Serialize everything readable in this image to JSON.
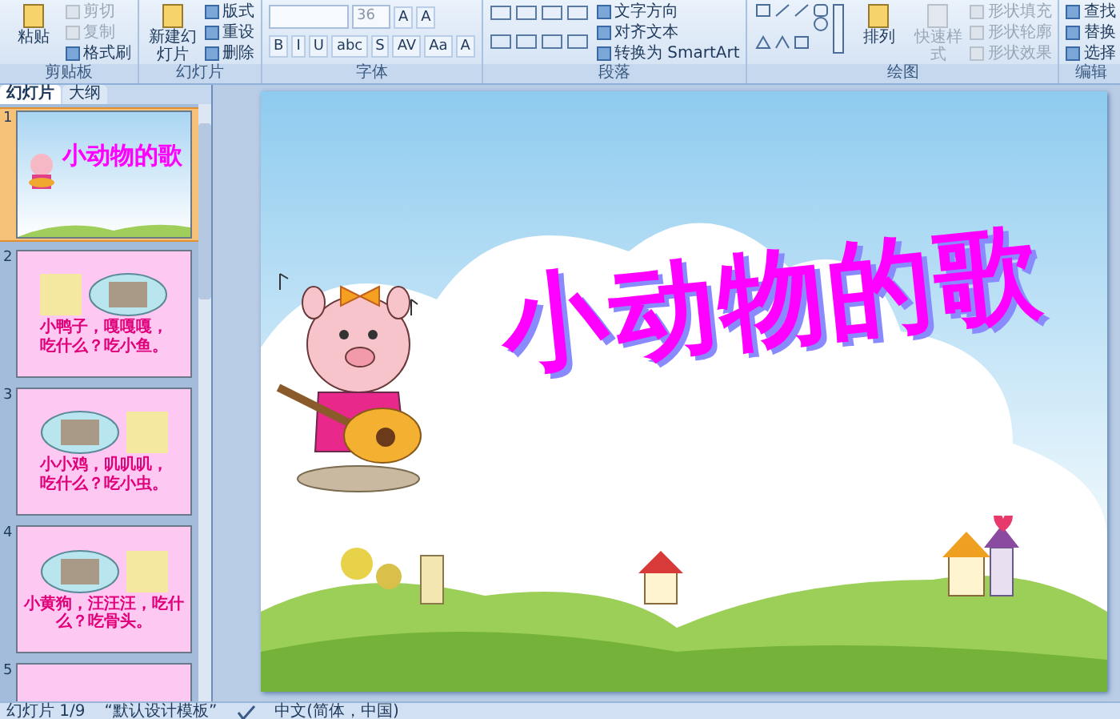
{
  "ribbon": {
    "groups": [
      {
        "label": "剪贴板",
        "kind": "plain",
        "buttons": [
          {
            "kind": "large",
            "label": "粘贴",
            "disabled": false
          },
          {
            "kind": "small",
            "label": "剪切",
            "disabled": true
          },
          {
            "kind": "small",
            "label": "复制",
            "disabled": true
          },
          {
            "kind": "small",
            "label": "格式刷",
            "disabled": false
          }
        ]
      },
      {
        "label": "幻灯片",
        "kind": "plain",
        "buttons": [
          {
            "kind": "large",
            "label": "新建幻灯片",
            "disabled": false
          },
          {
            "kind": "small",
            "label": "版式",
            "disabled": false
          },
          {
            "kind": "small",
            "label": "重设",
            "disabled": false
          },
          {
            "kind": "small",
            "label": "删除",
            "disabled": false
          }
        ]
      },
      {
        "label": "字体",
        "kind": "font",
        "size": "36",
        "glyph_rows": [
          [
            "A",
            "A"
          ],
          [
            "B",
            "I",
            "U",
            "abc",
            "S",
            "AV",
            "Aa",
            "A"
          ]
        ]
      },
      {
        "label": "段落",
        "kind": "paragraph",
        "buttons": [
          {
            "kind": "small",
            "label": "文字方向",
            "disabled": false
          },
          {
            "kind": "small",
            "label": "对齐文本",
            "disabled": false
          },
          {
            "kind": "small",
            "label": "转换为 SmartArt",
            "disabled": false
          }
        ]
      },
      {
        "label": "绘图",
        "kind": "drawing",
        "buttons": [
          {
            "kind": "large",
            "label": "排列",
            "disabled": false
          },
          {
            "kind": "large",
            "label": "快速样式",
            "disabled": true
          },
          {
            "kind": "small",
            "label": "形状填充",
            "disabled": true
          },
          {
            "kind": "small",
            "label": "形状轮廓",
            "disabled": true
          },
          {
            "kind": "small",
            "label": "形状效果",
            "disabled": true
          }
        ]
      },
      {
        "label": "编辑",
        "kind": "plain",
        "buttons": [
          {
            "kind": "small",
            "label": "查找",
            "disabled": false
          },
          {
            "kind": "small",
            "label": "替换",
            "disabled": false
          },
          {
            "kind": "small",
            "label": "选择",
            "disabled": false
          }
        ]
      }
    ]
  },
  "panel": {
    "tabs": [
      {
        "label": "幻灯片",
        "selected": true
      },
      {
        "label": "大纲",
        "selected": false
      }
    ],
    "slides": [
      {
        "number": "1",
        "selected": true,
        "kind": "title",
        "title": "小动物的歌"
      },
      {
        "number": "2",
        "selected": false,
        "kind": "animal-left",
        "lines": [
          "小鸭子，嘎嘎嘎，",
          "吃什么？吃小鱼。"
        ]
      },
      {
        "number": "3",
        "selected": false,
        "kind": "animal-right",
        "lines": [
          "小小鸡，叽叽叽，",
          "吃什么？吃小虫。"
        ]
      },
      {
        "number": "4",
        "selected": false,
        "kind": "animal-right",
        "lines": [
          "小黄狗，汪汪汪，吃什么？吃骨头。"
        ]
      },
      {
        "number": "5",
        "selected": false,
        "kind": "animal-right"
      }
    ]
  },
  "slide": {
    "title": "小动物的歌"
  },
  "status_bar": {
    "slide": "幻灯片 1/9",
    "theme": "“默认设计模板”",
    "language": "中文(简体，中国)"
  }
}
